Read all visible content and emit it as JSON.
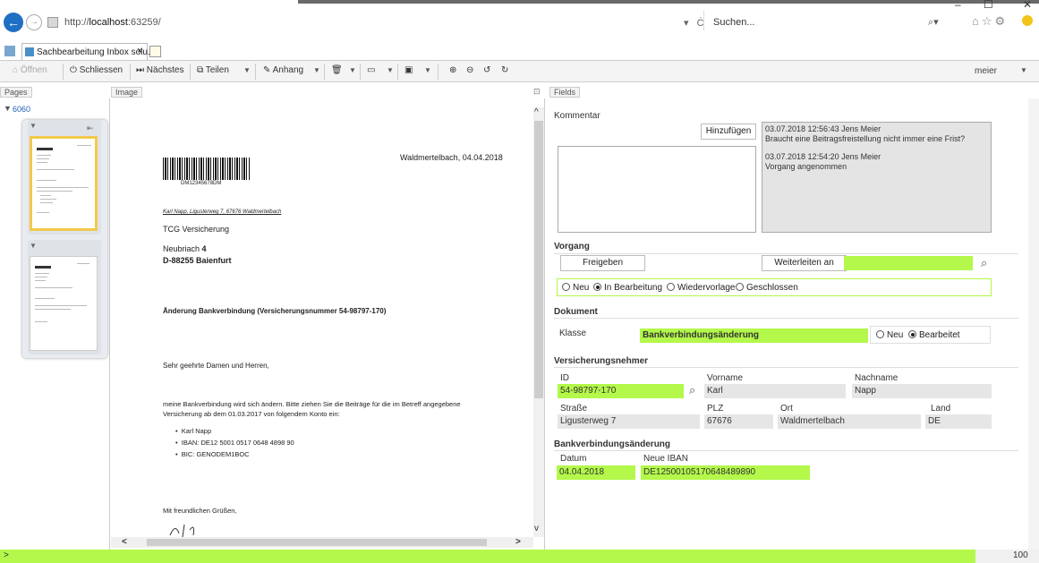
{
  "browser": {
    "url_prefix": "http://",
    "url_host": "localhost",
    "url_rest": ":63259/",
    "url_actions": "▾ Ċ",
    "search_placeholder": "Suchen...",
    "tab_title": "Sachbearbeitung Inbox solu...",
    "tab_close": "×",
    "win_min": "–",
    "win_max": "☐",
    "win_close": "✕"
  },
  "toolbar": {
    "open": "Öffnen",
    "close": "Schliessen",
    "next": "Nächstes",
    "share": "Teilen",
    "attachment": "Anhang",
    "user": "meier"
  },
  "panels": {
    "pages": "Pages",
    "image": "Image",
    "fields": "Fields"
  },
  "pages": {
    "group_label": "6060"
  },
  "document": {
    "city_date": "Waldmertelbach, 04.04.2018",
    "barcode_number": "DM12345678DM",
    "sender_line": "Karl Napp, Ligusterweg 7, 67676 Waldmertelbach",
    "recipient": "TCG Versicherung",
    "street_prefix": "Neubriach ",
    "street_number": "4",
    "postal_city": "D-88255 Baienfurt",
    "subject": "Änderung Bankverbindung (Versicherungsnummer 54-98797-170)",
    "salutation": "Sehr geehrte Damen und Herren,",
    "body1": "meine Bankverbindung wird sich ändern. Bitte ziehen Sie die Beiträge für die im Betreff angegebene",
    "body2": "Versicherung ab dem 01.03.2017 von folgendem Konto ein:",
    "bullets": [
      "Karl Napp",
      "IBAN: DE12 5001 0517 0648 4898 90",
      "BIC: GENODEM1BOC"
    ],
    "closing": "Mit freundlichen Grüßen,"
  },
  "fields": {
    "kommentar_label": "Kommentar",
    "add_button": "Hinzufügen",
    "comments": [
      {
        "head": "03.07.2018 12:56:43 Jens Meier",
        "text": "Braucht eine Beitragsfreistellung nicht immer eine Frist?"
      },
      {
        "head": "03.07.2018 12:54:20 Jens Meier",
        "text": "Vorgang angenommen"
      }
    ],
    "vorgang_label": "Vorgang",
    "release_button": "Freigeben",
    "forward_button": "Weiterleiten an",
    "status_options": [
      "Neu",
      "In Bearbeitung",
      "Wiedervorlage",
      "Geschlossen"
    ],
    "status_selected": "In Bearbeitung",
    "dokument_label": "Dokument",
    "klasse_label": "Klasse",
    "klasse_value": "Bankverbindungsänderung",
    "doc_state_options": [
      "Neu",
      "Bearbeitet"
    ],
    "doc_state_selected": "Bearbeitet",
    "vn_label": "Versicherungsnehmer",
    "id_label": "ID",
    "id_value": "54-98797-170",
    "vorname_label": "Vorname",
    "vorname_value": "Karl",
    "nachname_label": "Nachname",
    "nachname_value": "Napp",
    "strasse_label": "Straße",
    "strasse_value": "Ligusterweg 7",
    "plz_label": "PLZ",
    "plz_value": "67676",
    "ort_label": "Ort",
    "ort_value": "Waldmertelbach",
    "land_label": "Land",
    "land_value": "DE",
    "bank_label": "Bankverbindungsänderung",
    "datum_label": "Datum",
    "datum_value": "04.04.2018",
    "iban_label": "Neue IBAN",
    "iban_value": "DE12500105170648489890"
  },
  "statusbar": {
    "left": ">",
    "zoom": "100"
  },
  "colors": {
    "highlight": "#b3f84a",
    "selected_thumb": "#f2c94c",
    "back_button": "#1f6fc4"
  }
}
